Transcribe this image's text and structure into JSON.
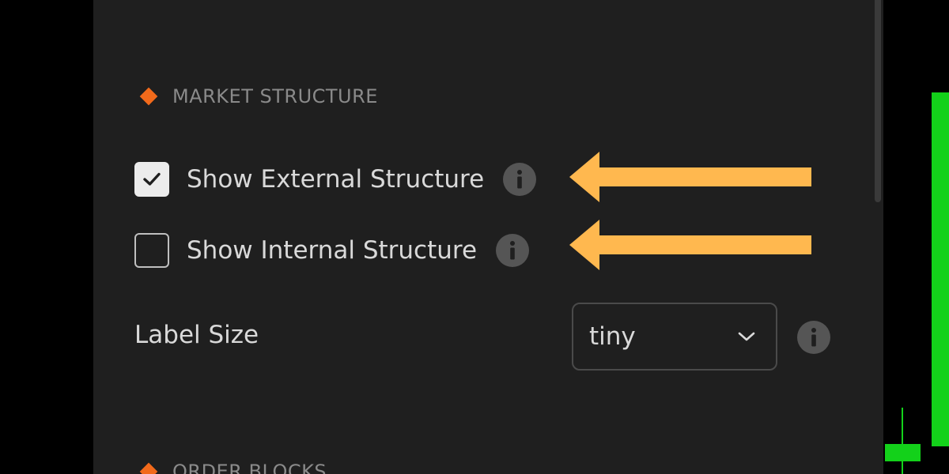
{
  "sections": {
    "market_structure": {
      "title": "MARKET STRUCTURE"
    },
    "order_blocks": {
      "title": "ORDER BLOCKS"
    }
  },
  "settings": {
    "show_external": {
      "label": "Show External Structure",
      "checked": true
    },
    "show_internal": {
      "label": "Show Internal Structure",
      "checked": false
    },
    "label_size": {
      "label": "Label Size",
      "value": "tiny"
    }
  },
  "colors": {
    "panel_bg": "#1f1f1f",
    "accent_diamond": "#f26a1b",
    "annotation_arrow": "#ffb84f",
    "candle_green": "#13d11a",
    "info_icon_bg": "#555555"
  },
  "icons": {
    "section": "diamond-icon",
    "check": "check-icon",
    "info": "info-icon",
    "chevron": "chevron-down-icon",
    "annotation": "arrow-left-icon"
  }
}
